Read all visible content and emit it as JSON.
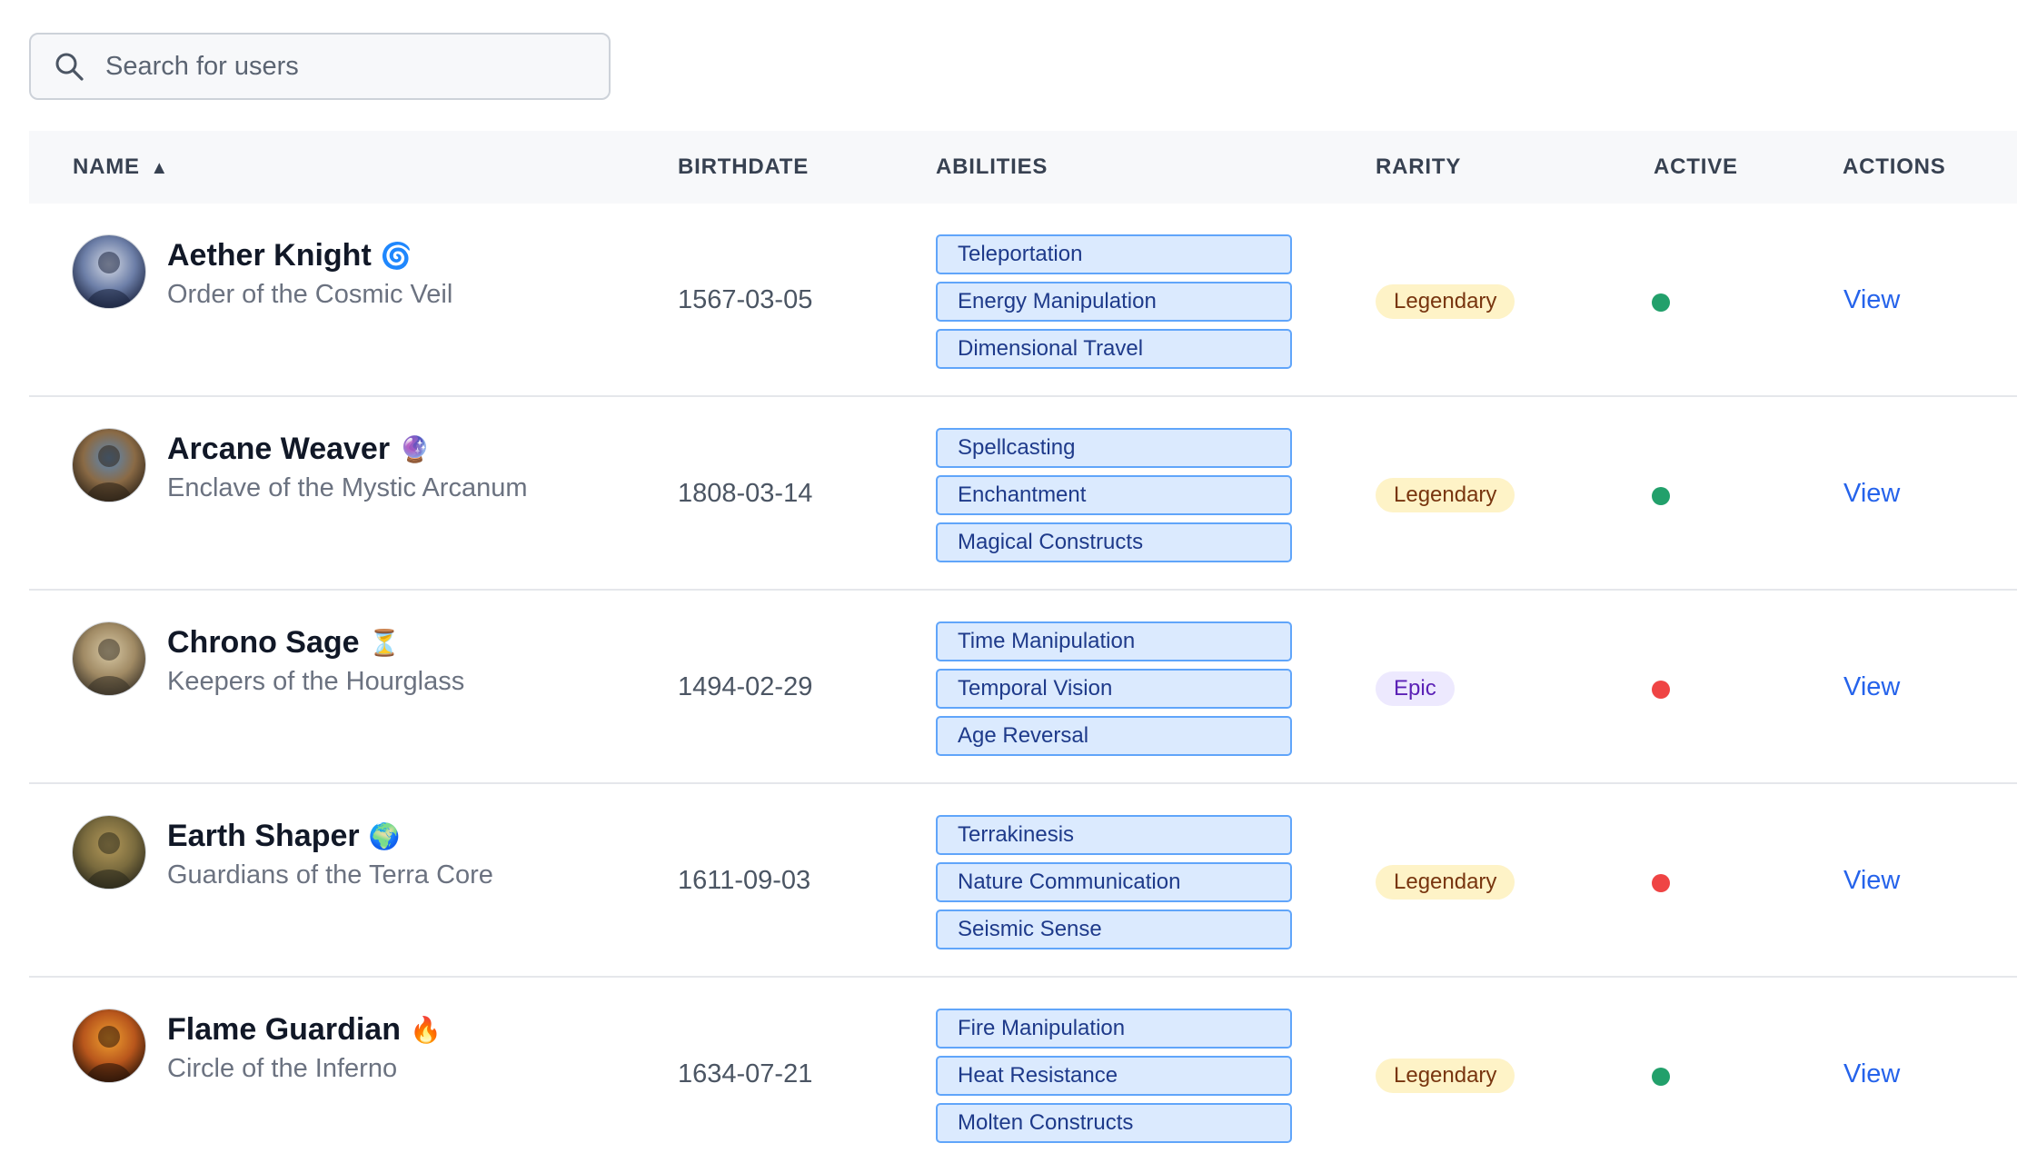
{
  "search": {
    "placeholder": "Search for users",
    "value": ""
  },
  "table": {
    "headers": {
      "name": "NAME",
      "name_sort_indicator": "▲",
      "birthdate": "BIRTHDATE",
      "abilities": "ABILITIES",
      "rarity": "RARITY",
      "active": "ACTIVE",
      "actions": "ACTIONS"
    },
    "rows": [
      {
        "name": "Aether Knight",
        "emoji": "🌀",
        "org": "Order of the Cosmic Veil",
        "birthdate": "1567-03-05",
        "abilities": [
          "Teleportation",
          "Energy Manipulation",
          "Dimensional Travel"
        ],
        "rarity": "Legendary",
        "active": true,
        "action": "View"
      },
      {
        "name": "Arcane Weaver",
        "emoji": "🔮",
        "org": "Enclave of the Mystic Arcanum",
        "birthdate": "1808-03-14",
        "abilities": [
          "Spellcasting",
          "Enchantment",
          "Magical Constructs"
        ],
        "rarity": "Legendary",
        "active": true,
        "action": "View"
      },
      {
        "name": "Chrono Sage",
        "emoji": "⏳",
        "org": "Keepers of the Hourglass",
        "birthdate": "1494-02-29",
        "abilities": [
          "Time Manipulation",
          "Temporal Vision",
          "Age Reversal"
        ],
        "rarity": "Epic",
        "active": false,
        "action": "View"
      },
      {
        "name": "Earth Shaper",
        "emoji": "🌍",
        "org": "Guardians of the Terra Core",
        "birthdate": "1611-09-03",
        "abilities": [
          "Terrakinesis",
          "Nature Communication",
          "Seismic Sense"
        ],
        "rarity": "Legendary",
        "active": false,
        "action": "View"
      },
      {
        "name": "Flame Guardian",
        "emoji": "🔥",
        "org": "Circle of the Inferno",
        "birthdate": "1634-07-21",
        "abilities": [
          "Fire Manipulation",
          "Heat Resistance",
          "Molten Constructs"
        ],
        "rarity": "Legendary",
        "active": true,
        "action": "View"
      }
    ]
  },
  "colors": {
    "active": "#22a06b",
    "inactive": "#ef4444",
    "link": "#2563eb",
    "ability_border": "#60a5fa",
    "ability_bg": "#dbeafe"
  },
  "icons": {
    "search": "search-icon",
    "avatar": "avatar"
  }
}
